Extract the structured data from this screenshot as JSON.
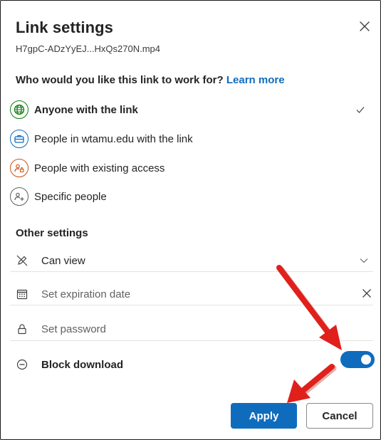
{
  "dialog": {
    "title": "Link settings",
    "filename": "H7gpC-ADzYyEJ...HxQs270N.mp4",
    "question": "Who would you like this link to work for?",
    "learn_more": "Learn more"
  },
  "audience_options": [
    {
      "label": "Anyone with the link",
      "icon": "globe-icon",
      "color": "#107c10",
      "selected": true
    },
    {
      "label": "People in wtamu.edu with the link",
      "icon": "briefcase-icon",
      "color": "#0f6cbd",
      "selected": false
    },
    {
      "label": "People with existing access",
      "icon": "people-lock-icon",
      "color": "#ca5010",
      "selected": false
    },
    {
      "label": "Specific people",
      "icon": "people-add-icon",
      "color": "#616161",
      "selected": false
    }
  ],
  "other_settings": {
    "heading": "Other settings",
    "permission": {
      "value": "Can view"
    },
    "expiration": {
      "placeholder": "Set expiration date"
    },
    "password": {
      "placeholder": "Set password"
    },
    "block_download": {
      "label": "Block download",
      "enabled": true
    }
  },
  "footer": {
    "apply_label": "Apply",
    "cancel_label": "Cancel"
  },
  "colors": {
    "accent": "#0f6cbd",
    "annotation_arrow": "#e0201b"
  }
}
